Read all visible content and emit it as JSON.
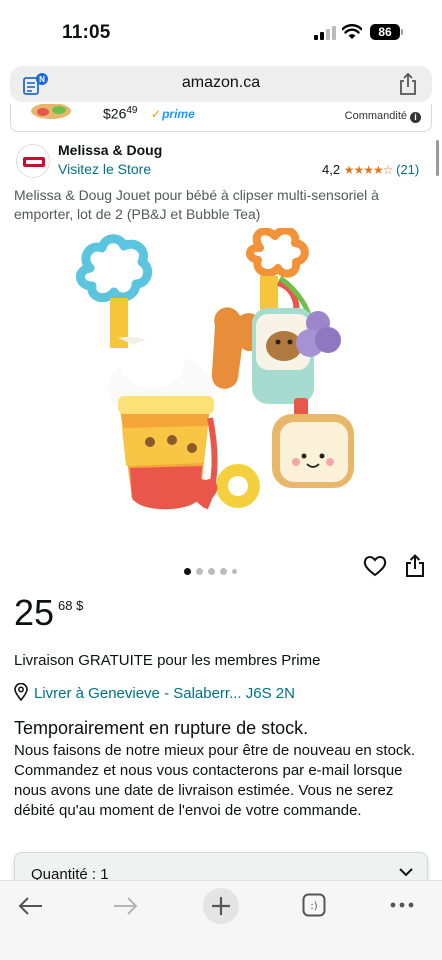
{
  "status_bar": {
    "time": "11:05",
    "battery": "86"
  },
  "browser": {
    "url": "amazon.ca",
    "reader_badge": "N"
  },
  "sponsored": {
    "price_main": "$26",
    "price_frac": "49",
    "prime": "prime",
    "label": "Commandité"
  },
  "brand": {
    "name": "Melissa & Doug",
    "store_link": "Visitez le Store"
  },
  "rating": {
    "value": "4,2",
    "stars": "★★★★☆",
    "count": "(21)"
  },
  "product": {
    "title": "Melissa & Doug Jouet pour bébé à clipser multi-sensoriel à emporter, lot de 2 (PB&J et Bubble Tea)",
    "price_whole": "25",
    "price_frac": "68 $"
  },
  "carousel": {
    "image_count": 5,
    "active_index": 0
  },
  "delivery": {
    "free_text": "Livraison GRATUITE pour les membres Prime",
    "deliver_to": "Livrer à Genevieve - Salaberr... J6S 2N"
  },
  "stock": {
    "title": "Temporairement en rupture de stock.",
    "body": "Nous faisons de notre mieux pour être de nouveau en stock. Commandez et nous vous contacterons par e-mail lorsque nous avons une date de livraison estimée. Vous ne serez débité qu'au moment de l'envoi de votre commande."
  },
  "quantity": {
    "label": "Quantité : 1"
  },
  "toolbar": {
    "tabs_label": ":)"
  },
  "colors": {
    "link": "#007185",
    "star": "#de7921",
    "prime": "#1a98ff",
    "text": "#0f1111",
    "muted": "#565959"
  }
}
